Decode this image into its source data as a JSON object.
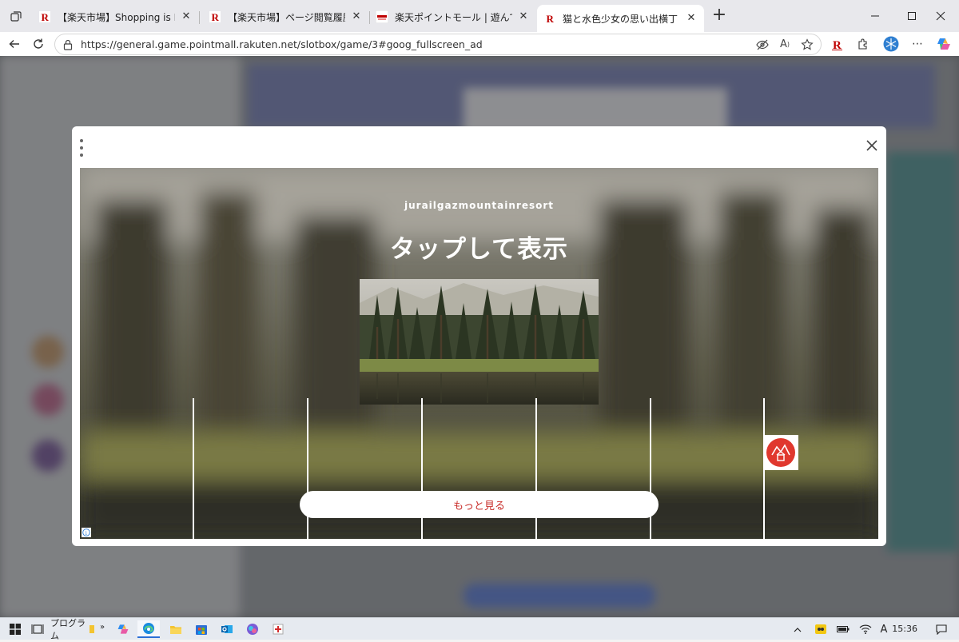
{
  "browser": {
    "tabs": [
      {
        "title": "【楽天市場】Shopping is Entertainme",
        "favicon": "rakuten-r-icon",
        "active": false
      },
      {
        "title": "【楽天市場】ページ閲覧履歴",
        "favicon": "rakuten-r-icon",
        "active": false
      },
      {
        "title": "楽天ポイントモール | 遊んで、貯って楽",
        "favicon": "pointmall-icon",
        "active": false
      },
      {
        "title": "猫と水色少女の思い出横丁｜スロッ",
        "favicon": "rakuten-r-icon",
        "active": true
      }
    ],
    "url": "https://general.game.pointmall.rakuten.net/slotbox/game/3#goog_fullscreen_ad"
  },
  "ad": {
    "brand": "jurailgazmountainresort",
    "headline": "タップして表示",
    "cta_label": "もっと見る",
    "info_label": "i"
  },
  "taskbar": {
    "programs_label": "プログラム",
    "time": "15:36",
    "ime_label": "A"
  },
  "colors": {
    "accent_red": "#bf0000",
    "cta_text": "#c9302c",
    "logo_red": "#e0382e"
  }
}
